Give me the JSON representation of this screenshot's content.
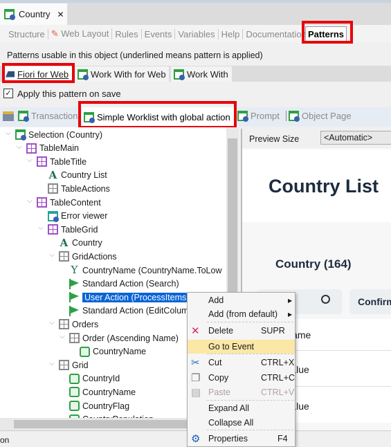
{
  "document_tab": {
    "title": "Country",
    "close": "✕"
  },
  "editor_tabs": [
    "Structure",
    "Web Layout",
    "Rules",
    "Events",
    "Variables",
    "Help",
    "Documentation"
  ],
  "active_editor_tab": "Patterns",
  "hint": "Patterns usable in this object (underlined means pattern is applied)",
  "pattern_tabs": [
    "Fiori for Web",
    "Work With for Web",
    "Work With"
  ],
  "apply_on_save": {
    "label": "Apply this pattern on save",
    "checked": true
  },
  "instance_tabs": [
    "Transaction",
    "Simple Worklist with global action",
    "Prompt",
    "Object Page"
  ],
  "tree": [
    {
      "label": "Selection (Country)",
      "icon": "window-icon"
    },
    {
      "label": "TableMain",
      "icon": "table-icon"
    },
    {
      "label": "TableTitle",
      "icon": "table-icon"
    },
    {
      "label": "Country List",
      "icon": "text-icon"
    },
    {
      "label": "TableActions",
      "icon": "table-gray-icon"
    },
    {
      "label": "TableContent",
      "icon": "table-icon"
    },
    {
      "label": "Error viewer",
      "icon": "error-viewer-icon"
    },
    {
      "label": "TableGrid",
      "icon": "table-icon"
    },
    {
      "label": "Country",
      "icon": "text-icon"
    },
    {
      "label": "GridActions",
      "icon": "table-gray-icon"
    },
    {
      "label": "CountryName (CountryName.ToLow",
      "icon": "filter-icon"
    },
    {
      "label": "Standard Action (Search)",
      "icon": "flag-icon"
    },
    {
      "label": "User Action (ProcessItems)",
      "icon": "flag-icon",
      "selected": true
    },
    {
      "label": "Standard Action (EditColum",
      "icon": "flag-icon"
    },
    {
      "label": "Orders",
      "icon": "orders-icon"
    },
    {
      "label": "Order (Ascending Name)",
      "icon": "orders-icon"
    },
    {
      "label": "CountryName",
      "icon": "attribute-icon"
    },
    {
      "label": "Grid",
      "icon": "grid-icon"
    },
    {
      "label": "CountryId",
      "icon": "attribute-icon"
    },
    {
      "label": "CountryName",
      "icon": "attribute-icon"
    },
    {
      "label": "CountryFlag",
      "icon": "attribute-icon"
    },
    {
      "label": "CountryPopulation",
      "icon": "attribute-icon"
    }
  ],
  "status_text": "on",
  "preview": {
    "size_label": "Preview Size",
    "size_value": "<Automatic>",
    "title": "Country List",
    "grid_title": "Country (164)",
    "confirm": "Confirm",
    "column": "Name",
    "cells": [
      "Value",
      "Value"
    ]
  },
  "context_menu": [
    {
      "label": "Add",
      "submenu": true
    },
    {
      "label": "Add (from default)",
      "submenu": true
    },
    {
      "label": "Delete",
      "shortcut": "SUPR",
      "icon": "delete-icon"
    },
    {
      "label": "Go to Event",
      "highlighted": true
    },
    {
      "label": "Cut",
      "shortcut": "CTRL+X",
      "icon": "cut-icon"
    },
    {
      "label": "Copy",
      "shortcut": "CTRL+C",
      "icon": "copy-icon"
    },
    {
      "label": "Paste",
      "shortcut": "CTRL+V",
      "icon": "paste-icon",
      "disabled": true
    },
    {
      "label": "Expand All"
    },
    {
      "label": "Collapse All"
    },
    {
      "label": "Properties",
      "shortcut": "F4",
      "icon": "gear-icon"
    }
  ],
  "colors": {
    "highlight_box": "#e8000b",
    "selection": "#0a64d6",
    "menu_hover": "#fbe7a6"
  }
}
